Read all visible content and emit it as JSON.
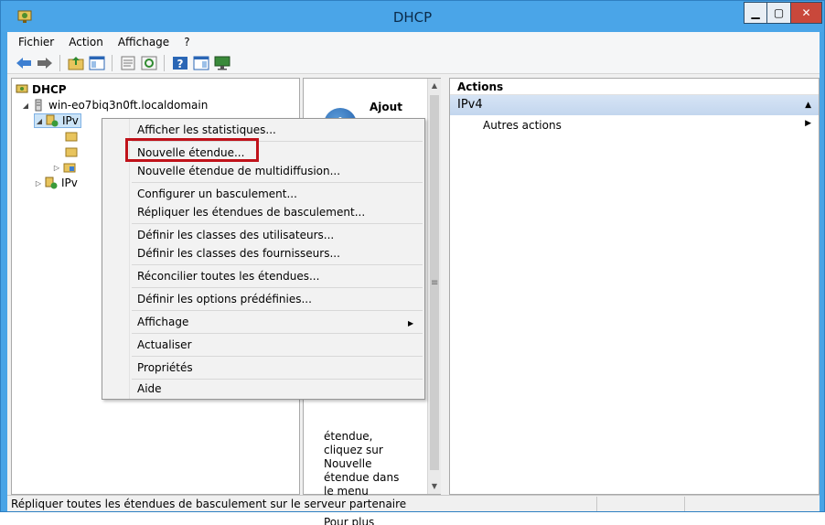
{
  "window": {
    "title": "DHCP",
    "minimize_glyph": "▁",
    "maximize_glyph": "▢",
    "close_glyph": "✕",
    "accent_color": "#4aa5e8",
    "close_color": "#c9483b"
  },
  "menubar": {
    "items": [
      "Fichier",
      "Action",
      "Affichage",
      "?"
    ]
  },
  "toolbar": {
    "buttons": [
      "back-icon",
      "forward-icon",
      "up-folder-icon",
      "show-hide-tree-icon",
      "properties-icon",
      "refresh-icon",
      "help-icon",
      "export-list-icon",
      "monitor-icon"
    ]
  },
  "tree": {
    "root": "DHCP",
    "server": "win-eo7biq3n0ft.localdomain",
    "ipv4": "IPv",
    "ipv6": "IPv"
  },
  "center": {
    "heading": "Ajout",
    "info_glyph": "i",
    "text": "étendue,\ncliquez sur\nNouvelle\nétendue dans\nle menu\nAction.",
    "cut_text": "Pour plus"
  },
  "actions": {
    "header": "Actions",
    "section": "IPv4",
    "item": "Autres actions"
  },
  "context_menu": {
    "items": [
      "Afficher les statistiques...",
      "Nouvelle étendue...",
      "Nouvelle étendue de multidiffusion...",
      "Configurer un basculement...",
      "Répliquer les étendues de basculement...",
      "Définir les classes des utilisateurs...",
      "Définir les classes des fournisseurs...",
      "Réconcilier toutes les étendues...",
      "Définir les options prédéfinies...",
      "Affichage",
      "Actualiser",
      "Propriétés",
      "Aide"
    ],
    "highlight_color": "#c0121a"
  },
  "statusbar": {
    "text": "Répliquer toutes les étendues de basculement sur le serveur partenaire"
  }
}
